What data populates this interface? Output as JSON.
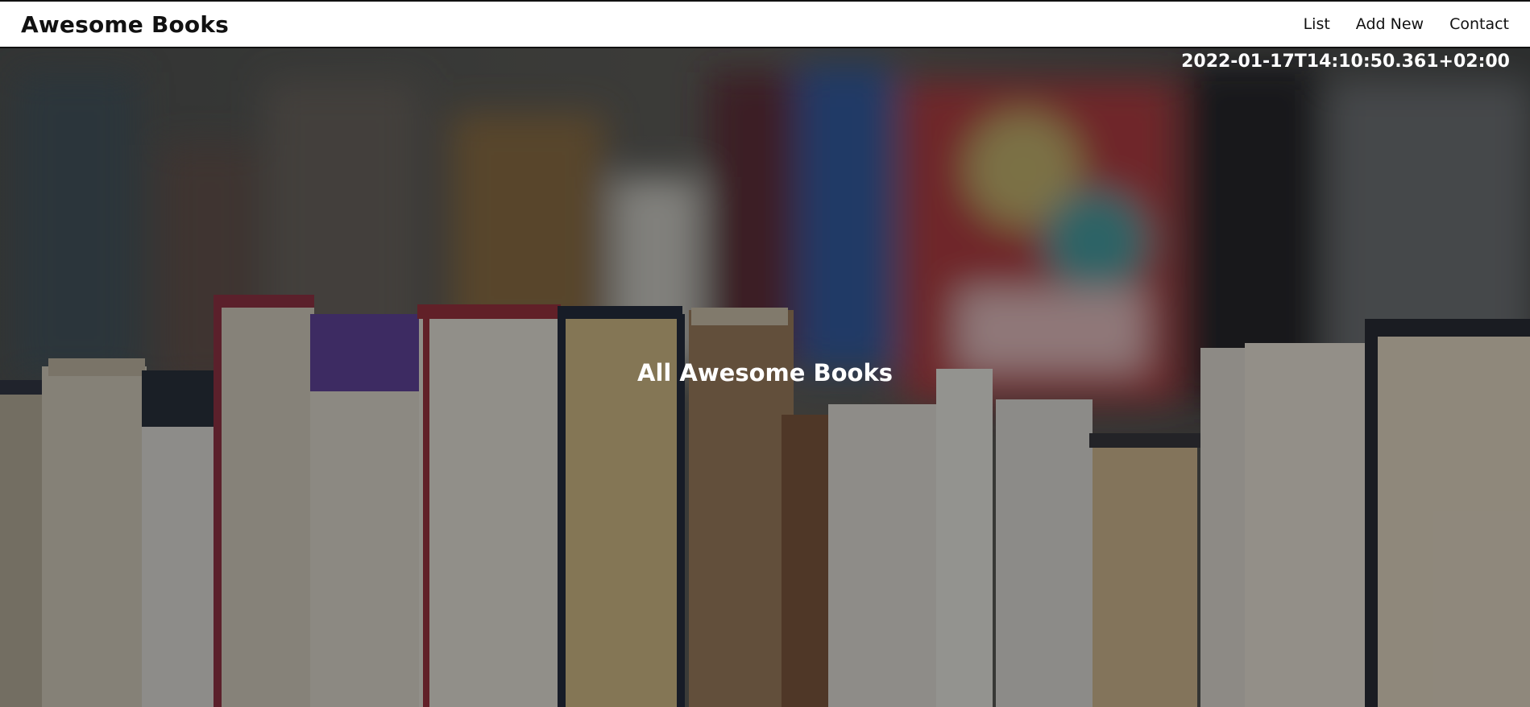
{
  "header": {
    "brand": "Awesome Books",
    "nav": [
      {
        "label": "List"
      },
      {
        "label": "Add New"
      },
      {
        "label": "Contact"
      }
    ]
  },
  "hero": {
    "datetime": "2022-01-17T14:10:50.361+02:00",
    "title": "All Awesome Books",
    "background_image": "books-on-shelf-photo"
  },
  "colors": {
    "navbar_bg": "#ffffff",
    "text_light": "#ffffff",
    "text_dark": "#111111"
  }
}
